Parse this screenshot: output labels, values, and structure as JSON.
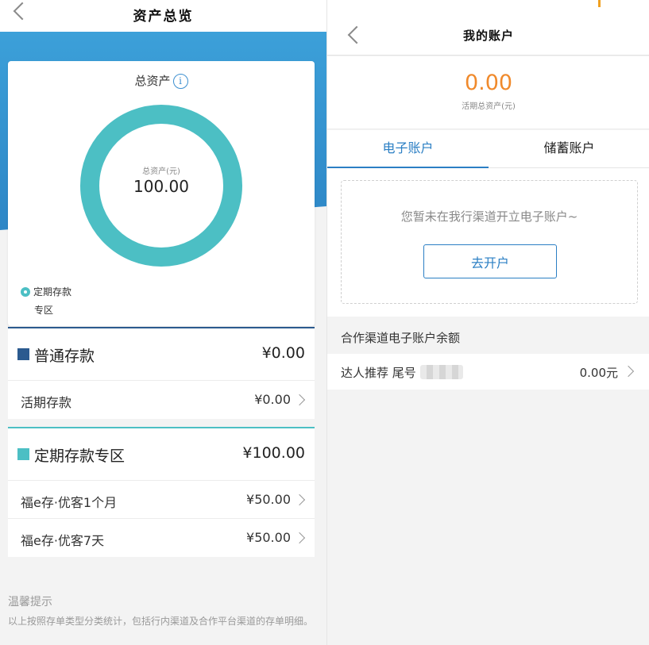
{
  "left": {
    "nav_title": "资产总览",
    "card": {
      "title": "总资产",
      "ring_label": "总资产(元)",
      "ring_value": "100.00",
      "legend_line1": "定期存款",
      "legend_line2": "专区"
    },
    "groups": [
      {
        "name": "普通存款",
        "amount": "¥0.00",
        "color": "#2b5a8f",
        "items": [
          {
            "name": "活期存款",
            "amount": "¥0.00"
          }
        ]
      },
      {
        "name": "定期存款专区",
        "amount": "¥100.00",
        "color": "#4cbfc4",
        "items": [
          {
            "name": "福e存·优客1个月",
            "amount": "¥50.00"
          },
          {
            "name": "福e存·优客7天",
            "amount": "¥50.00"
          }
        ]
      }
    ],
    "tips": {
      "title": "温馨提示",
      "body": "以上按照存单类型分类统计，包括行内渠道及合作平台渠道的存单明细。"
    }
  },
  "right": {
    "nav_title": "我的账户",
    "total_value": "0.00",
    "total_label": "活期总资产(元)",
    "tabs": [
      "电子账户",
      "储蓄账户"
    ],
    "empty_message": "您暂未在我行渠道开立电子账户~",
    "open_button": "去开户",
    "coop_title": "合作渠道电子账户余额",
    "coop_row": {
      "name": "达人推荐 尾号",
      "amount": "0.00元"
    }
  },
  "colors": {
    "accent_blue": "#2b7fc4",
    "teal": "#4cbfc4",
    "orange": "#f08a2c"
  }
}
